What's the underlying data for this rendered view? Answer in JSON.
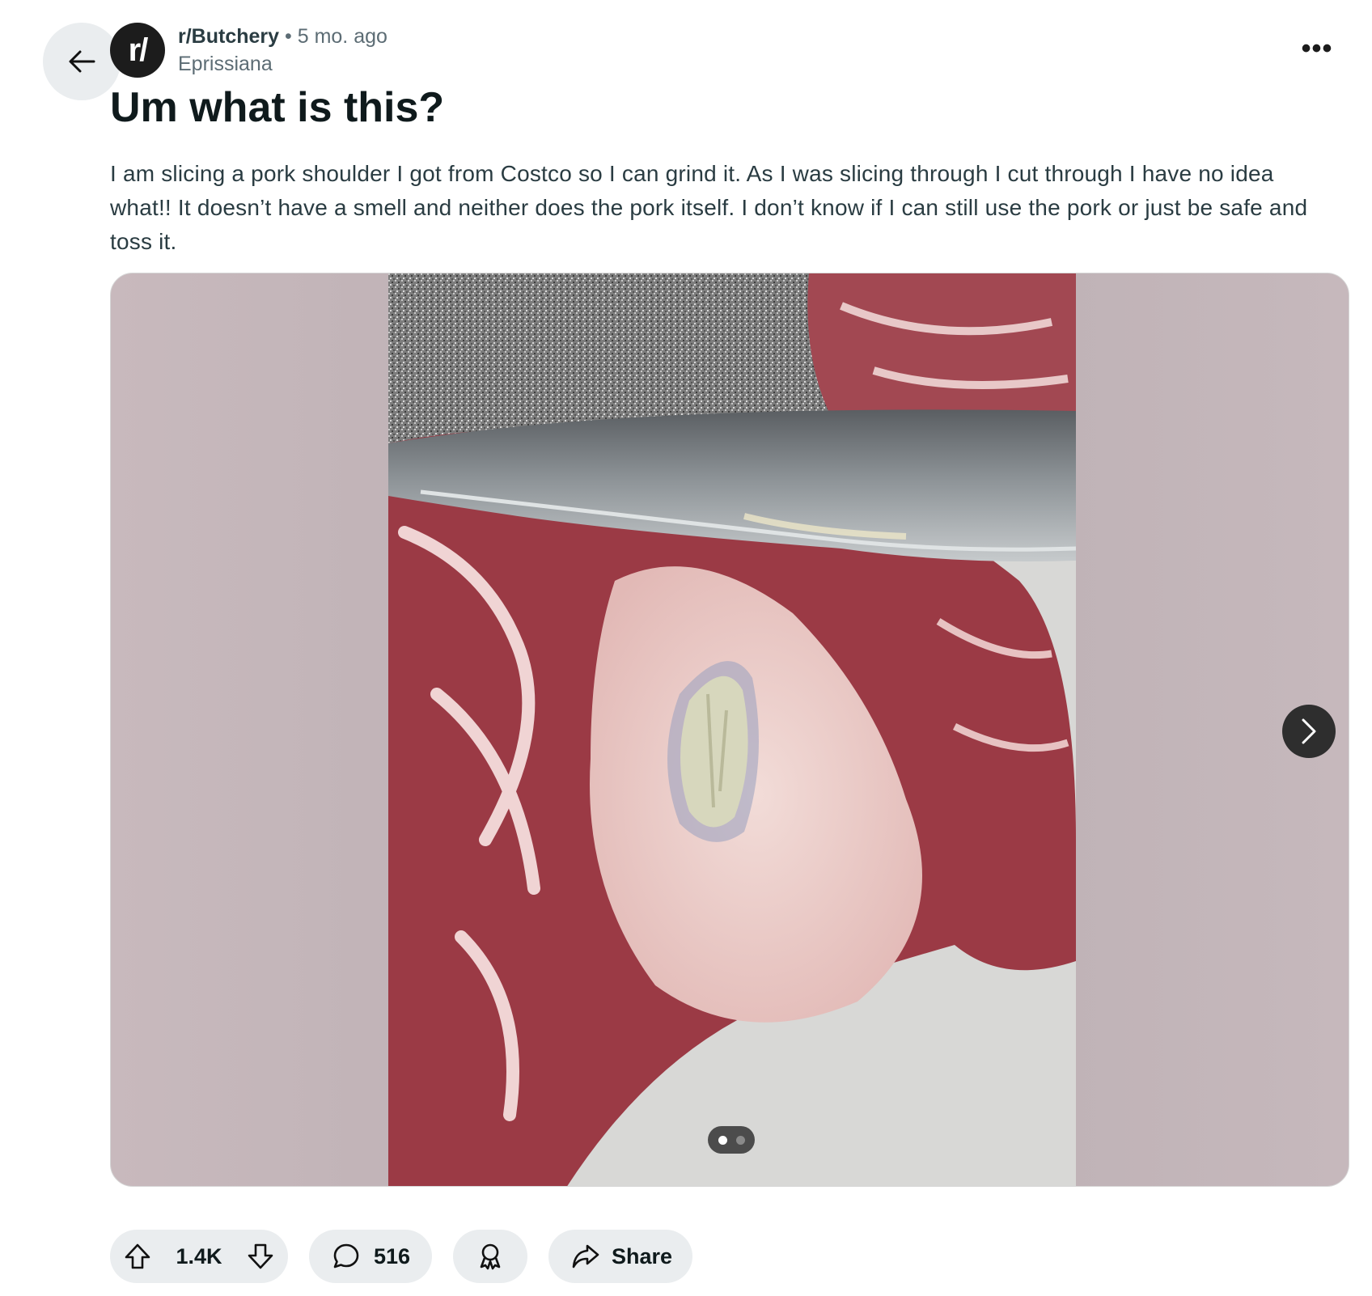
{
  "header": {
    "avatar_text": "r/",
    "subreddit": "r/Butchery",
    "separator": "•",
    "age": "5 mo. ago",
    "author": "Eprissiana",
    "more_label": "•••"
  },
  "post": {
    "title": "Um what is this?",
    "body": "I am slicing a pork shoulder I got from Costco so I can grind it. As I was slicing through I cut through I have no idea what!! It doesn’t have a smell and neither does the pork itself. I don’t know if I can still use the pork or just be safe and toss it."
  },
  "gallery": {
    "image_count": 2,
    "current_index": 1
  },
  "actions": {
    "vote_count": "1.4K",
    "comment_count": "516",
    "share_label": "Share"
  },
  "icons": {
    "back": "arrow-left-icon",
    "more": "ellipsis-icon",
    "next": "chevron-right-icon",
    "upvote": "arrow-up-icon",
    "downvote": "arrow-down-icon",
    "comment": "speech-bubble-icon",
    "award": "award-ribbon-icon",
    "share": "share-arrow-icon"
  }
}
